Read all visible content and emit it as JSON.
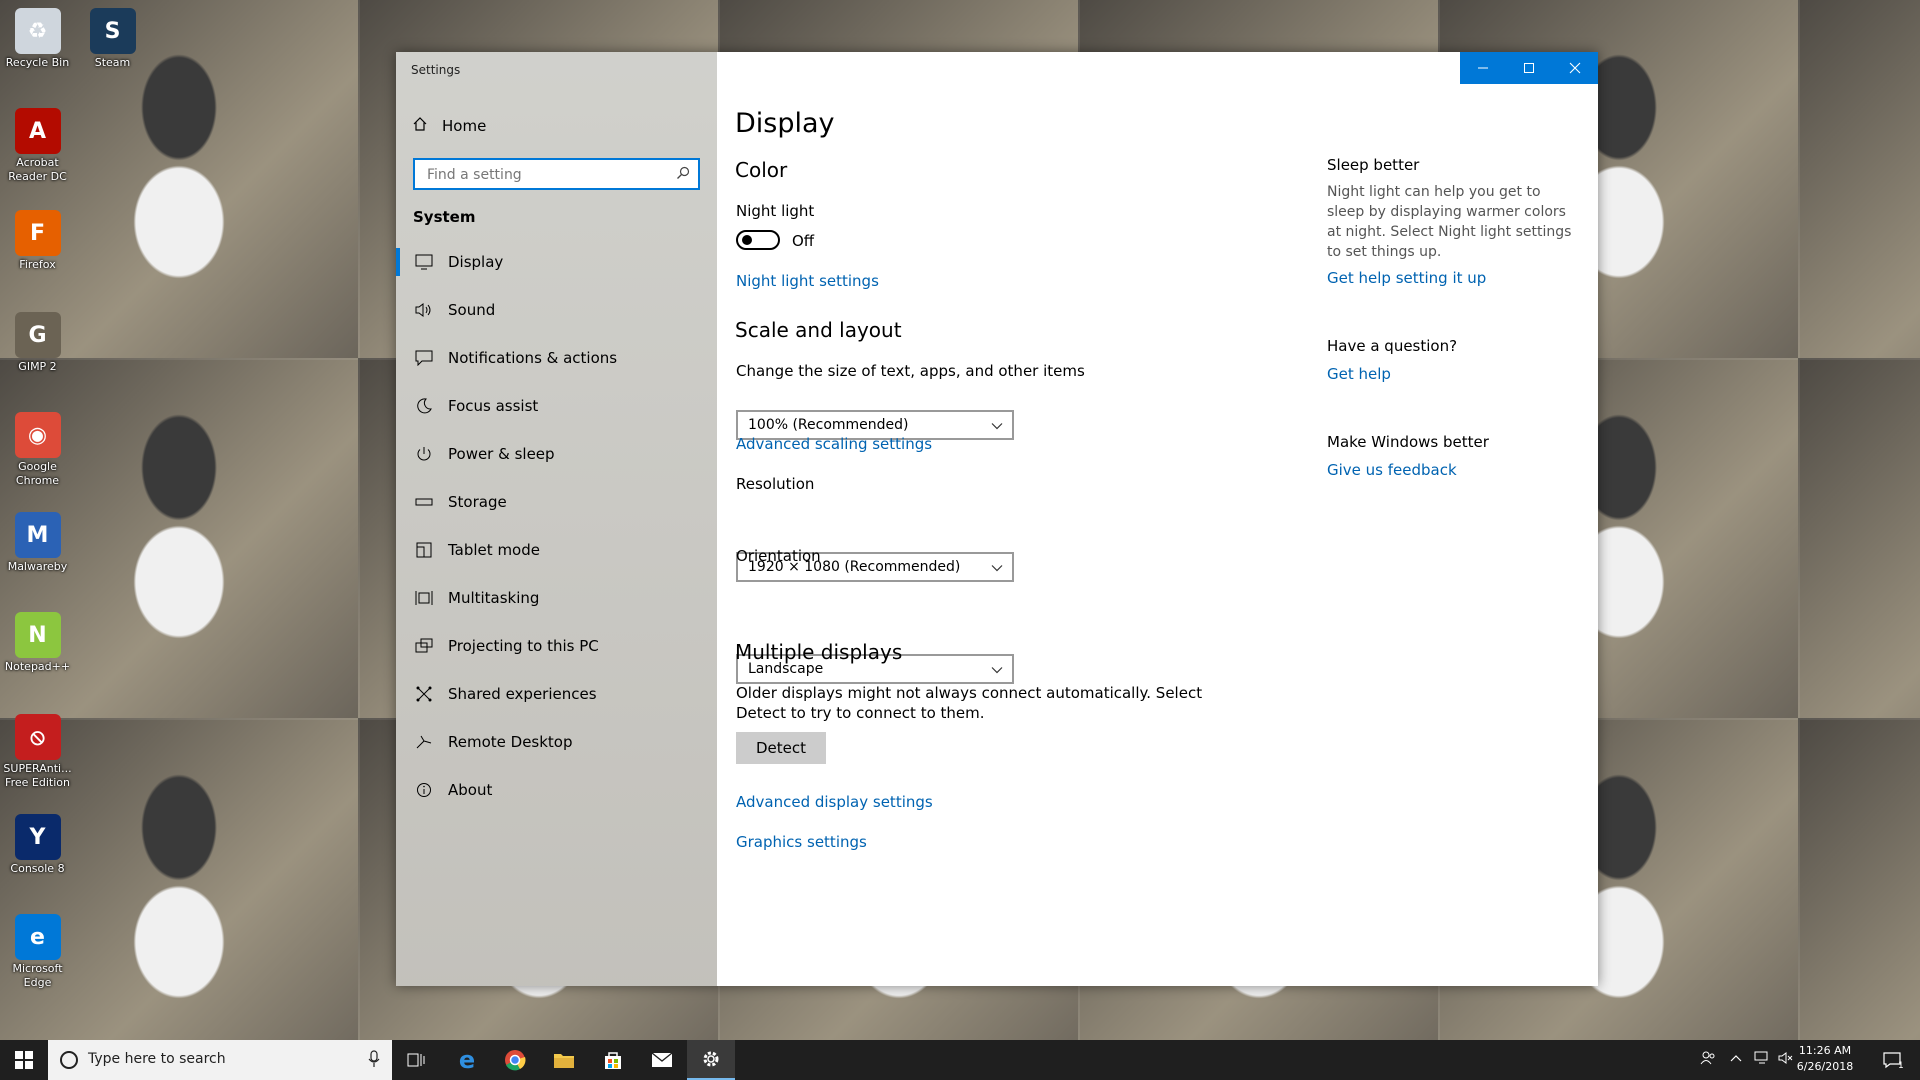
{
  "desktop": {
    "icons": [
      {
        "label": "Recycle Bin",
        "icon": "recycle-bin-icon",
        "color": "#cfd6dd",
        "glyph": "♻"
      },
      {
        "label": "Steam",
        "icon": "steam-icon",
        "color": "#1b3b5a",
        "glyph": "S"
      },
      {
        "label": "Acrobat Reader DC",
        "icon": "acrobat-icon",
        "color": "#b30b00",
        "glyph": "A"
      },
      {
        "label": "Firefox",
        "icon": "firefox-icon",
        "color": "#e66000",
        "glyph": "F"
      },
      {
        "label": "GIMP 2",
        "icon": "gimp-icon",
        "color": "#6b6354",
        "glyph": "G"
      },
      {
        "label": "Google Chrome",
        "icon": "chrome-icon",
        "color": "#dd4b39",
        "glyph": "◉"
      },
      {
        "label": "Malwareby",
        "icon": "malwarebytes-icon",
        "color": "#2b62b5",
        "glyph": "M"
      },
      {
        "label": "Notepad++",
        "icon": "notepadpp-icon",
        "color": "#8cc63f",
        "glyph": "N"
      },
      {
        "label": "SUPERAnti... Free Edition",
        "icon": "superantispyware-icon",
        "color": "#c41e1e",
        "glyph": "⦸"
      },
      {
        "label": "Console 8",
        "icon": "console-icon",
        "color": "#0a2a6b",
        "glyph": "Y"
      },
      {
        "label": "Microsoft Edge",
        "icon": "edge-icon",
        "color": "#0078d7",
        "glyph": "e"
      }
    ]
  },
  "window": {
    "title": "Settings",
    "accent": "#0078d7",
    "sidebar": {
      "home_label": "Home",
      "search_placeholder": "Find a setting",
      "section": "System",
      "items": [
        {
          "label": "Display",
          "icon": "monitor-icon",
          "active": true
        },
        {
          "label": "Sound",
          "icon": "speaker-icon"
        },
        {
          "label": "Notifications & actions",
          "icon": "notification-icon"
        },
        {
          "label": "Focus assist",
          "icon": "moon-icon"
        },
        {
          "label": "Power & sleep",
          "icon": "power-icon"
        },
        {
          "label": "Storage",
          "icon": "storage-icon"
        },
        {
          "label": "Tablet mode",
          "icon": "tablet-icon"
        },
        {
          "label": "Multitasking",
          "icon": "multitasking-icon"
        },
        {
          "label": "Projecting to this PC",
          "icon": "projecting-icon"
        },
        {
          "label": "Shared experiences",
          "icon": "shared-icon"
        },
        {
          "label": "Remote Desktop",
          "icon": "remote-desktop-icon"
        },
        {
          "label": "About",
          "icon": "info-icon"
        }
      ]
    },
    "main": {
      "title": "Display",
      "color_heading": "Color",
      "night_light_label": "Night light",
      "night_light_state": "Off",
      "night_light_settings_link": "Night light settings",
      "scale_heading": "Scale and layout",
      "scale_label": "Change the size of text, apps, and other items",
      "scale_value": "100% (Recommended)",
      "advanced_scaling_link": "Advanced scaling settings",
      "resolution_label": "Resolution",
      "resolution_value": "1920 × 1080 (Recommended)",
      "orientation_label": "Orientation",
      "orientation_value": "Landscape",
      "multiple_heading": "Multiple displays",
      "multiple_text_1": "Older displays might not always connect automatically. Select",
      "multiple_text_2": "Detect to try to connect to them.",
      "detect_button": "Detect",
      "advanced_display_link": "Advanced display settings",
      "graphics_link": "Graphics settings"
    },
    "right_panel": {
      "sleep_title": "Sleep better",
      "sleep_text": [
        "Night light can help you get to",
        "sleep by displaying warmer colors",
        "at night. Select Night light settings",
        "to set things up."
      ],
      "sleep_link": "Get help setting it up",
      "question_title": "Have a question?",
      "question_link": "Get help",
      "better_title": "Make Windows better",
      "better_link": "Give us feedback"
    }
  },
  "taskbar": {
    "search_placeholder": "Type here to search",
    "time": "11:26 AM",
    "date": "6/26/2018",
    "notification_count": "1"
  }
}
